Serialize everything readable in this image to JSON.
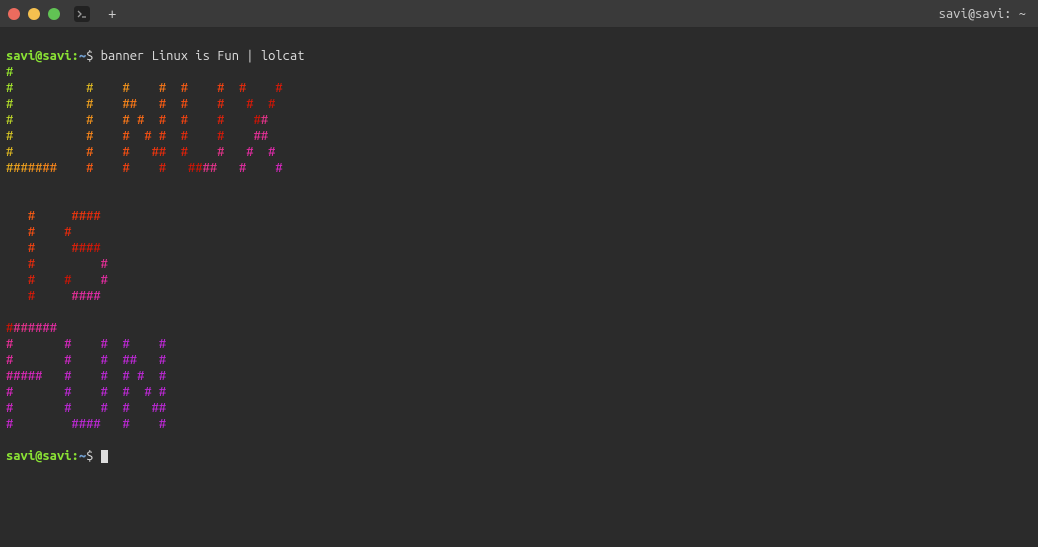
{
  "title": "savi@savi: ~",
  "prompt": {
    "user": "savi@savi",
    "colon": ":",
    "path": "~",
    "dollar": "$"
  },
  "command": "banner Linux is Fun | lolcat",
  "banner_output": [
    "#",
    "#          #    #    #  #    #  #    #",
    "#          #    ##   #  #    #   #  #",
    "#          #    # #  #  #    #    ##",
    "#          #    #  # #  #    #    ##",
    "#          #    #   ##  #    #   #  #",
    "#######    #    #    #   ####   #    #",
    "",
    "",
    "   #     ####",
    "   #    #",
    "   #     ####",
    "   #         #",
    "   #    #    #",
    "   #     ####",
    "",
    "#######",
    "#       #    #  #    #",
    "#       #    #  ##   #",
    "#####   #    #  # #  #",
    "#       #    #  #  # #",
    "#       #    #  #   ##",
    "#        ####   #    #"
  ],
  "plus_label": "+"
}
